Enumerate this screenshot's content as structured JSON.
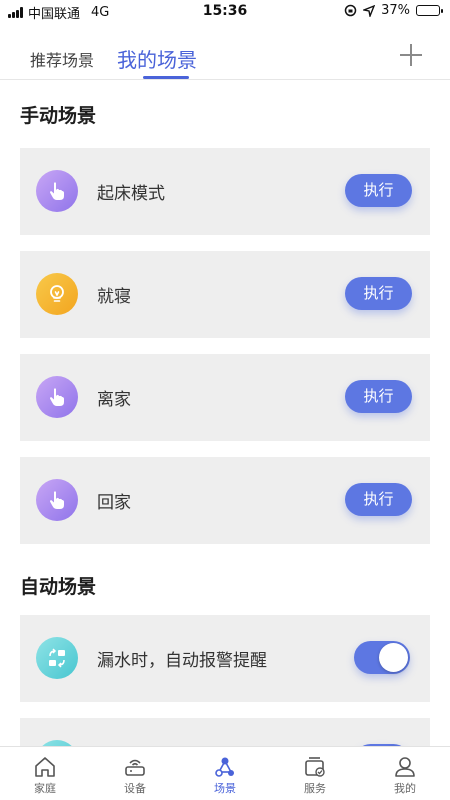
{
  "status_bar": {
    "carrier": "中国联通",
    "network": "4G",
    "time": "15:36",
    "battery": "37%",
    "battery_level": 0.37
  },
  "top_tabs": {
    "recommend": "推荐场景",
    "mine": "我的场景",
    "active": "mine"
  },
  "manual_section": {
    "title": "手动场景",
    "scenes": [
      {
        "name": "起床模式",
        "icon": "hand-pointer-icon",
        "action": "执行"
      },
      {
        "name": "就寝",
        "icon": "lightbulb-icon",
        "action": "执行"
      },
      {
        "name": "离家",
        "icon": "hand-pointer-icon",
        "action": "执行"
      },
      {
        "name": "回家",
        "icon": "hand-pointer-icon",
        "action": "执行"
      }
    ]
  },
  "auto_section": {
    "title": "自动场景",
    "scenes": [
      {
        "name": "漏水时，自动报警提醒",
        "icon": "swap-arrows-icon",
        "enabled": true
      },
      {
        "name": "",
        "icon": "swap-arrows-icon",
        "enabled": true
      }
    ]
  },
  "bottom_nav": [
    {
      "label": "家庭",
      "icon": "home-icon"
    },
    {
      "label": "设备",
      "icon": "router-icon"
    },
    {
      "label": "场景",
      "icon": "scene-nodes-icon",
      "active": true
    },
    {
      "label": "服务",
      "icon": "service-folder-icon"
    },
    {
      "label": "我的",
      "icon": "person-icon"
    }
  ],
  "colors": {
    "accent": "#5d77e2",
    "tab_active": "#4a63d9",
    "card_bg": "#eeeeee",
    "hand_icon": "#a98bf0",
    "bulb_icon": "#f5b433",
    "water_icon": "#5fd3d9"
  }
}
